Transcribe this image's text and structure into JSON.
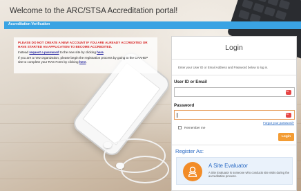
{
  "header": {
    "title": "Welcome to the ARC/STSA Accreditation portal!"
  },
  "nav": {
    "active_tab": "Accreditation Verification"
  },
  "notice": {
    "warning": "PLEASE DO NOT CREATE A NEW ACCOUNT IF YOU ARE ALREADY ACCREDITED OR HAVE STARTED AN APPLICATION TO BECOME ACCREDITED.",
    "line1_pre": "Instead ",
    "line1_link": "request a password",
    "line1_mid": " to the new site by clicking ",
    "line1_link2": "here",
    "line1_end": ".",
    "line2_pre": "If you are a new organization, please begin the registration process by going to the CAAHEP site to complete your RAS Form by clicking ",
    "line2_link": "here",
    "line2_end": "."
  },
  "login": {
    "title": "Login",
    "instructions": "Enter your User ID or Email Address and Password below to log in.",
    "user_label": "User ID or Email",
    "user_value": "",
    "password_label": "Password",
    "password_value": "",
    "forgot": "Forgot your password?",
    "remember": "Remember me",
    "button": "Login"
  },
  "register": {
    "heading": "Register As:",
    "evaluator_title": "A Site Evaluator",
    "evaluator_desc": "A Site Evaluator is someone who conducts site visits during the accreditation process."
  },
  "colors": {
    "accent_blue": "#3aa3e3",
    "warning_red": "#d62020",
    "button_orange": "#f39c34",
    "link_blue": "#2a6ac4"
  }
}
